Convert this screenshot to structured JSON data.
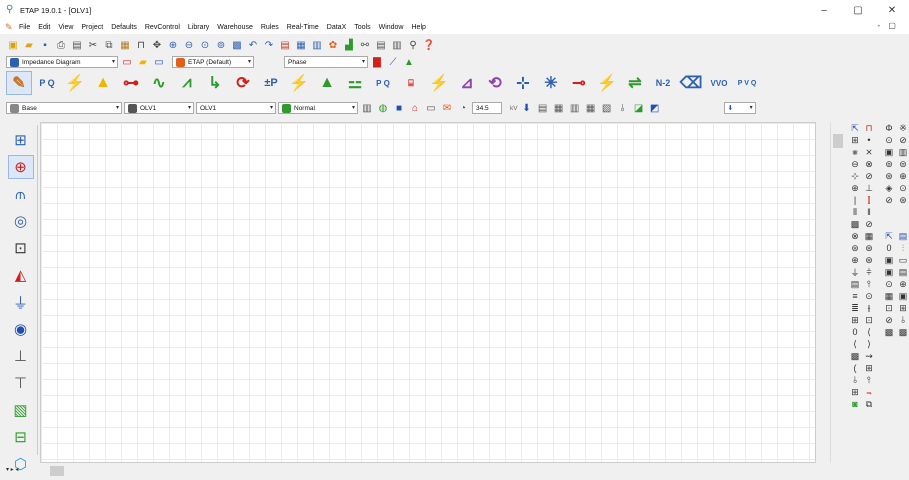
{
  "window": {
    "title": "ETAP 19.0.1 - [OLV1]",
    "minimize": "–",
    "maximize": "▢",
    "close": "✕",
    "mdi_controls": "- ▢"
  },
  "menu": [
    "File",
    "Edit",
    "View",
    "Project",
    "Defaults",
    "RevControl",
    "Library",
    "Warehouse",
    "Rules",
    "Real-Time",
    "DataX",
    "Tools",
    "Window",
    "Help"
  ],
  "toolbar2": {
    "view_select": "Impedance Diagram",
    "study_select": "ETAP (Default)",
    "phase_select": "Phase"
  },
  "toolbar3": {
    "pq_label": "P Q",
    "p_label": "±P",
    "n2_label": "N-2",
    "vvo_label": "VVO",
    "pvq_label": "P V Q"
  },
  "toolbar4": {
    "base_select": "Base",
    "config_select": "OLV1",
    "olv_select": "OLV1",
    "normal_select": "Normal",
    "kv_value": "34.5",
    "kv_unit": "kV"
  },
  "icons": {
    "pencil": "✎",
    "accent_colors": {
      "red": "#d0201c",
      "blue": "#1f4fb4",
      "green": "#2e9a2e",
      "yellow": "#f0b400"
    }
  },
  "status": {
    "left_text": "▾ ▸ ◂"
  }
}
